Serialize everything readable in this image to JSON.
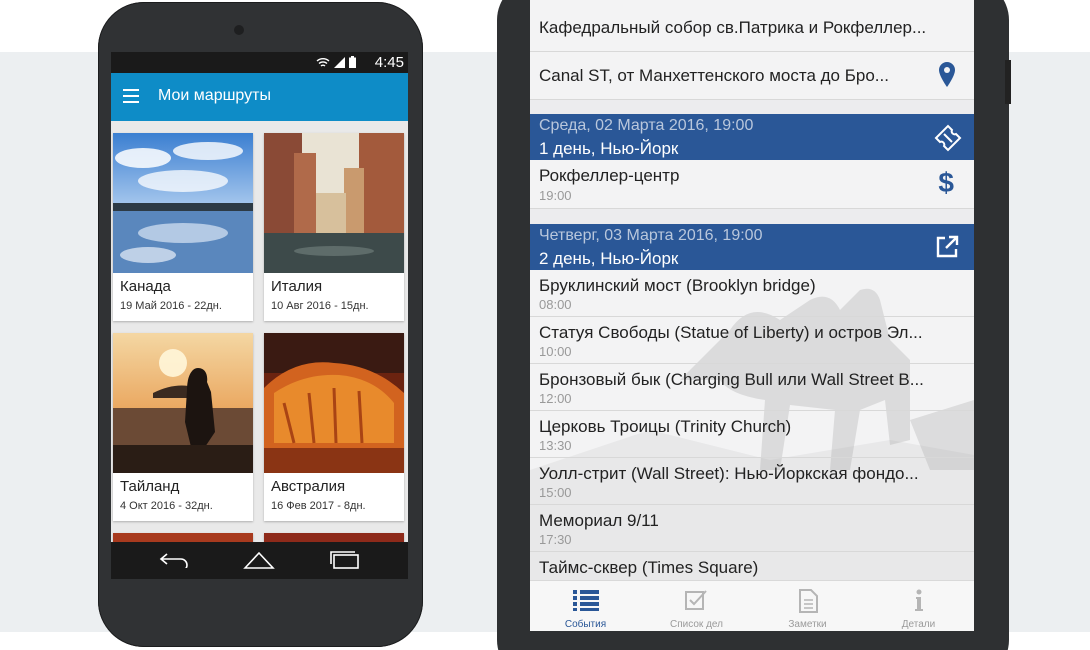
{
  "phone_left": {
    "status_bar": {
      "time": "4:45"
    },
    "app_bar": {
      "title": "Мои маршруты"
    },
    "routes": [
      {
        "name": "Канада",
        "meta": "19 Май 2016 - 22дн."
      },
      {
        "name": "Италия",
        "meta": "10 Авг 2016 - 15дн."
      },
      {
        "name": "Тайланд",
        "meta": "4 Окт 2016 - 32дн."
      },
      {
        "name": "Австралия",
        "meta": "16 Фев 2017 - 8дн."
      }
    ]
  },
  "phone_right": {
    "top_events": [
      {
        "title": "Кафедральный собор св.Патрика и Рокфеллер..."
      },
      {
        "title": "Canal ST, от Манхеттенского моста до Бро..."
      }
    ],
    "days": [
      {
        "date": "Среда, 02 Марта 2016, 19:00",
        "label": "1 день, Нью-Йорк",
        "icon": "ticket-icon",
        "events": [
          {
            "title": "Рокфеллер-центр",
            "time": "19:00"
          }
        ]
      },
      {
        "date": "Четверг, 03 Марта 2016, 19:00",
        "label": "2 день, Нью-Йорк",
        "icon": "external-link-icon",
        "events": [
          {
            "title": "Бруклинский мост (Brooklyn bridge)",
            "time": "08:00"
          },
          {
            "title": "Статуя Свободы (Statue of Liberty) и остров Эл...",
            "time": "10:00"
          },
          {
            "title": "Бронзовый бык (Charging Bull или Wall Street B...",
            "time": "12:00"
          },
          {
            "title": "Церковь Троицы (Trinity Church)",
            "time": "13:30"
          },
          {
            "title": "Уолл-стрит (Wall Street): Нью-Йоркская фондо...",
            "time": "15:00"
          },
          {
            "title": "Мемориал 9/11",
            "time": "17:30"
          },
          {
            "title": "Таймс-сквер (Times Square)",
            "time": ""
          }
        ]
      }
    ],
    "tabs": [
      {
        "label": "События",
        "icon": "list-icon",
        "active": true
      },
      {
        "label": "Список дел",
        "icon": "checkbox-icon",
        "active": false
      },
      {
        "label": "Заметки",
        "icon": "note-icon",
        "active": false
      },
      {
        "label": "Детали",
        "icon": "info-icon",
        "active": false
      }
    ],
    "colors": {
      "accent": "#2a5797",
      "app_bar": "#0e8cc7"
    }
  }
}
